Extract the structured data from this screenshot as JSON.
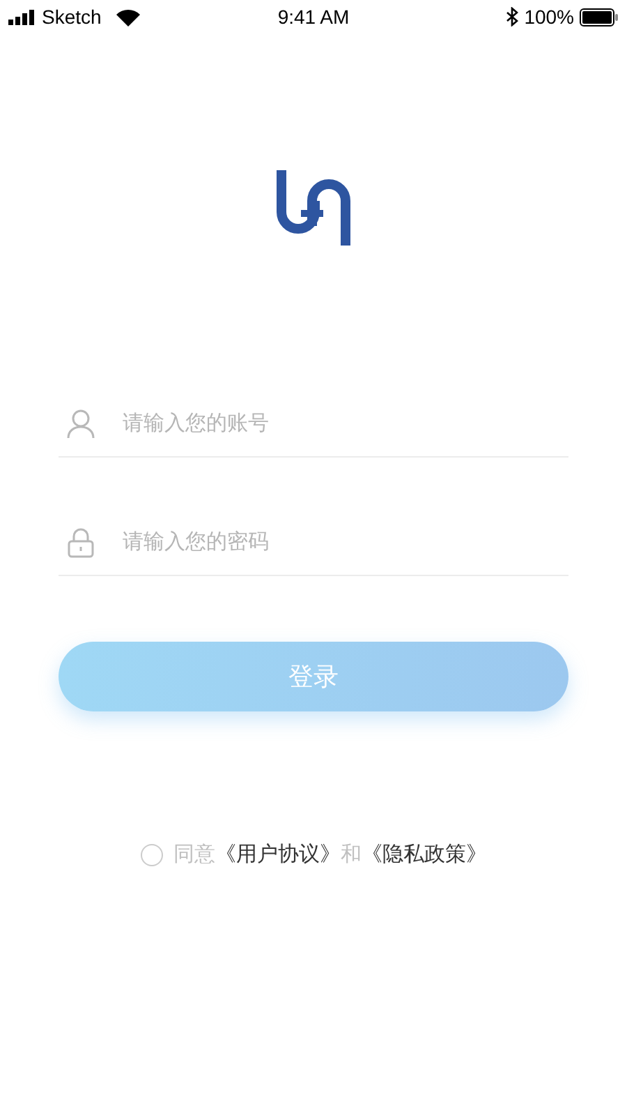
{
  "status_bar": {
    "carrier": "Sketch",
    "time": "9:41 AM",
    "battery": "100%"
  },
  "fields": [
    {
      "kind": "user",
      "placeholder": "请输入您的账号"
    },
    {
      "kind": "lock",
      "placeholder": "请输入您的密码"
    }
  ],
  "login_button": {
    "label": "登录"
  },
  "agreement": {
    "checked": false,
    "prefix": "同意",
    "link_1": "《用户协议》",
    "joiner": "和",
    "link_2": "《隐私政策》"
  }
}
